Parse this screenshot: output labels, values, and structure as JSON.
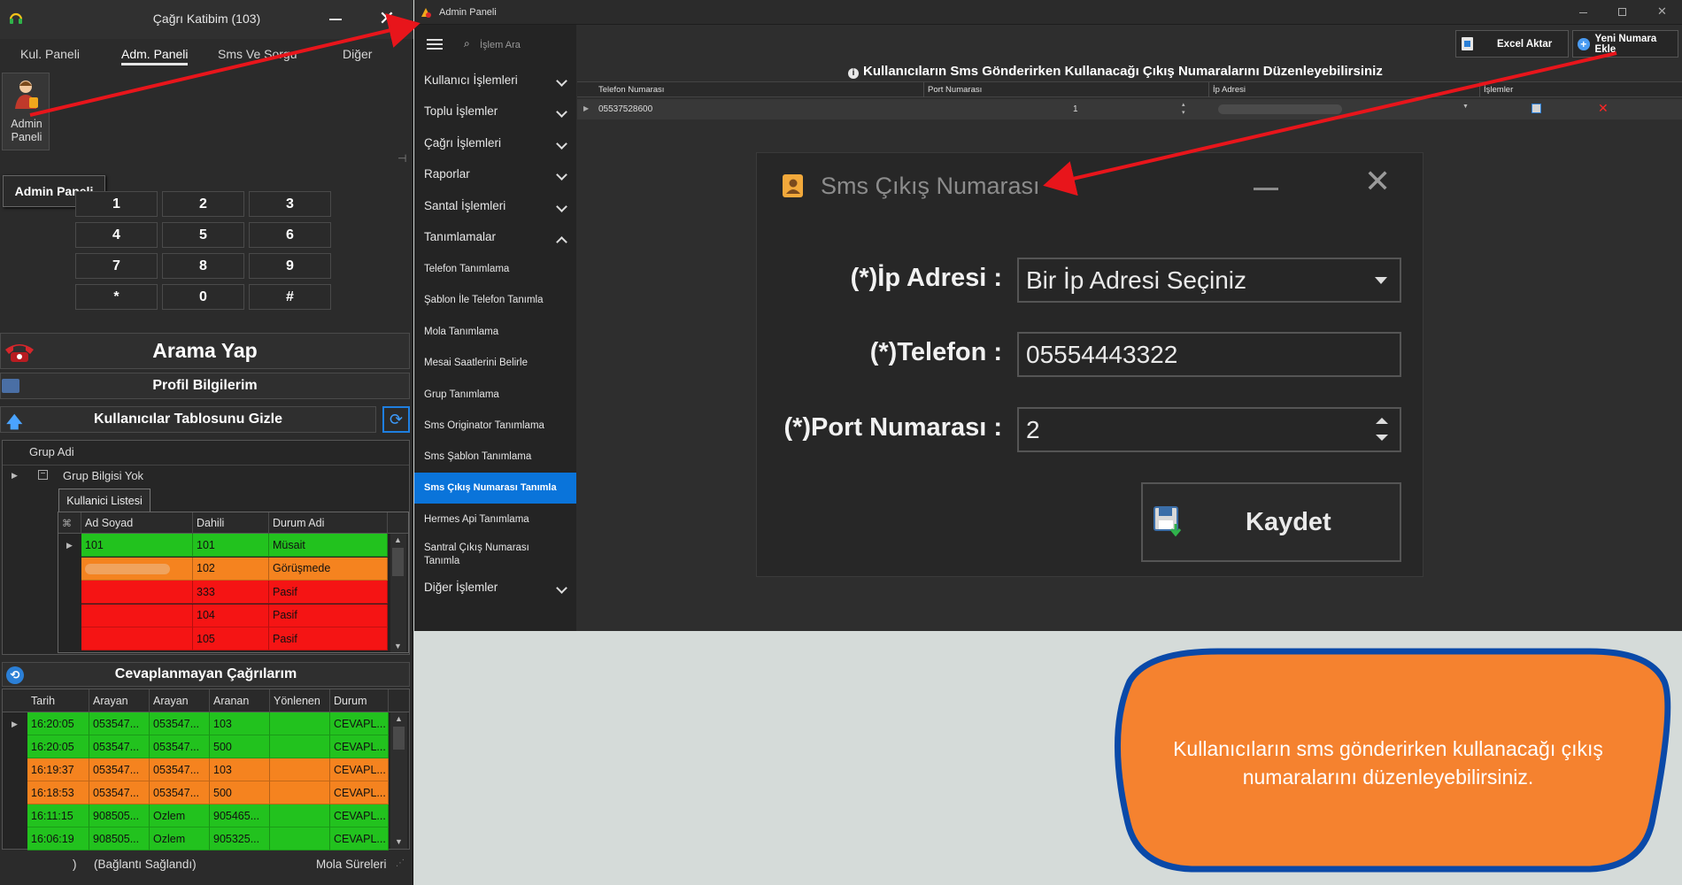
{
  "left_window": {
    "title": "Çağrı Katibim (103)",
    "tabs": [
      "Kul. Paneli",
      "Adm. Paneli",
      "Sms Ve Sorgu",
      "Diğer"
    ],
    "admin_icon_label_1": "Admin",
    "admin_icon_label_2": "Paneli",
    "tooltip": "Admin Paneli",
    "keypad": [
      "1",
      "2",
      "3",
      "4",
      "5",
      "6",
      "7",
      "8",
      "9",
      "*",
      "0",
      "#"
    ],
    "call_button": "Arama Yap",
    "profile_button": "Profil Bilgilerim",
    "users_table_toggle": "Kullanıcılar Tablosunu Gizle",
    "group_header": "Grup Adi",
    "group_row": "Grup Bilgisi Yok",
    "user_list_tab": "Kullanici Listesi",
    "user_columns": [
      "Ad Soyad",
      "Dahili",
      "Durum Adi"
    ],
    "users": [
      {
        "name": "101",
        "ext": "101",
        "status": "Müsait",
        "color": "#22c21e"
      },
      {
        "name": "",
        "ext": "102",
        "status": "Görüşmede",
        "color": "#f5831f"
      },
      {
        "name": "",
        "ext": "333",
        "status": "Pasif",
        "color": "#f51414"
      },
      {
        "name": "",
        "ext": "104",
        "status": "Pasif",
        "color": "#f51414"
      },
      {
        "name": "",
        "ext": "105",
        "status": "Pasif",
        "color": "#f51414"
      }
    ],
    "missed_calls_title": "Cevaplanmayan Çağrılarım",
    "missed_columns": [
      "Tarih",
      "Arayan",
      "Arayan",
      "Aranan",
      "Yönlenen",
      "Durum"
    ],
    "missed_calls": [
      {
        "time": "16:20:05",
        "caller": "053547...",
        "caller2": "053547...",
        "called": "103",
        "routed": "",
        "state": "CEVAPL...",
        "color": "#22c21e"
      },
      {
        "time": "16:20:05",
        "caller": "053547...",
        "caller2": "053547...",
        "called": "500",
        "routed": "",
        "state": "CEVAPL...",
        "color": "#22c21e"
      },
      {
        "time": "16:19:37",
        "caller": "053547...",
        "caller2": "053547...",
        "called": "103",
        "routed": "",
        "state": "CEVAPL...",
        "color": "#f5831f"
      },
      {
        "time": "16:18:53",
        "caller": "053547...",
        "caller2": "053547...",
        "called": "500",
        "routed": "",
        "state": "CEVAPL...",
        "color": "#f5831f"
      },
      {
        "time": "16:11:15",
        "caller": "908505...",
        "caller2": "Ozlem",
        "called": "905465...",
        "routed": "",
        "state": "CEVAPL...",
        "color": "#22c21e"
      },
      {
        "time": "16:06:19",
        "caller": "908505...",
        "caller2": "Ozlem",
        "called": "905325...",
        "routed": "",
        "state": "CEVAPL...",
        "color": "#22c21e"
      }
    ],
    "status_left": ")",
    "status_text": "(Bağlantı Sağlandı)",
    "status_right": "Mola Süreleri"
  },
  "admin_window": {
    "title": "Admin Paneli",
    "search_placeholder": "İşlem Ara",
    "nav_groups": [
      "Kullanıcı İşlemleri",
      "Toplu İşlemler",
      "Çağrı İşlemleri",
      "Raporlar",
      "Santal İşlemleri",
      "Tanımlamalar"
    ],
    "nav_sub": [
      "Telefon Tanımlama",
      "Şablon İle Telefon Tanımla",
      "Mola Tanımlama",
      "Mesai Saatlerini Belirle",
      "Grup Tanımlama",
      "Sms Originator Tanımlama",
      "Sms Şablon Tanımlama",
      "Sms Çıkış Numarası Tanımla",
      "Hermes Api Tanımlama",
      "Santral Çıkış Numarası Tanımla"
    ],
    "nav_last": "Diğer İşlemler",
    "active_nav": "Sms Çıkış Numarası Tanımla",
    "excel_button": "Excel Aktar",
    "new_number_button": "Yeni Numara Ekle",
    "page_heading": "Kullanıcıların Sms Gönderirken Kullanacağı Çıkış Numaralarını Düzenleyebilirsiniz",
    "grid_columns": [
      "Telefon Numarası",
      "Port Numarası",
      "İp Adresi",
      "İşlemler"
    ],
    "grid_row": {
      "phone": "05537528600",
      "port": "1"
    }
  },
  "dialog": {
    "title": "Sms Çıkış Numarası",
    "ip_label": "(*)İp Adresi :",
    "ip_value": "Bir İp Adresi Seçiniz",
    "phone_label": "(*)Telefon :",
    "phone_value": "05554443322",
    "port_label": "(*)Port Numarası :",
    "port_value": "2",
    "save_button": "Kaydet"
  },
  "callout": {
    "text": "Kullanıcıların sms gönderirken kullanacağı çıkış numaralarını düzenleyebilirsiniz."
  },
  "colors": {
    "accent_blue": "#0a74da",
    "arrow_red": "#e8151b",
    "callout_orange": "#f5822f",
    "callout_border": "#0a49a8"
  }
}
